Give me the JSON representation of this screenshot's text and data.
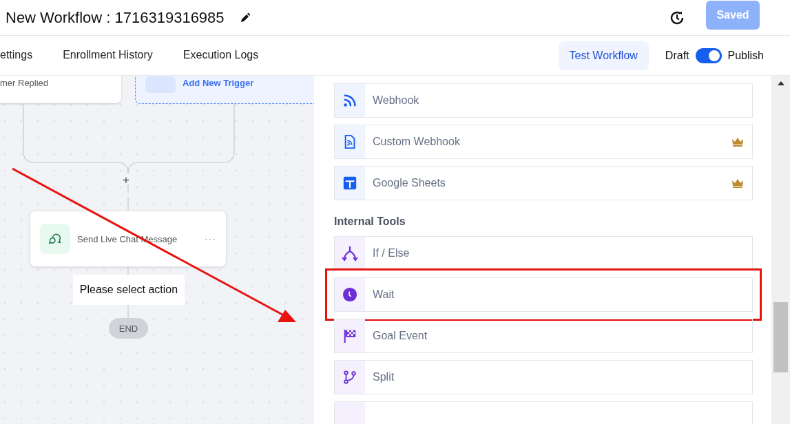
{
  "header": {
    "title": "New Workflow : 1716319316985",
    "save_button": "Saved"
  },
  "tabs": [
    {
      "label": "ettings",
      "selected": false
    },
    {
      "label": "Enrollment History",
      "selected": false
    },
    {
      "label": "Execution Logs",
      "selected": false
    }
  ],
  "test_button": "Test Workflow",
  "publish_toggle": {
    "off_label": "Draft",
    "on_label": "Publish",
    "on": true
  },
  "canvas": {
    "trigger_text": "mer Replied",
    "add_trigger": "Add New Trigger",
    "add_step": "+",
    "action_node": {
      "title": "Send Live Chat Message",
      "menu": "···"
    },
    "placeholder_node": "Please select action",
    "end_node": "END"
  },
  "sections": [
    {
      "items": [
        {
          "label": "Webhook",
          "kind": "rss",
          "premium": false
        },
        {
          "label": "Custom Webhook",
          "kind": "doc",
          "premium": true
        },
        {
          "label": "Google Sheets",
          "kind": "sheet",
          "premium": true
        }
      ]
    },
    {
      "heading": "Internal Tools",
      "items": [
        {
          "label": "If / Else",
          "kind": "fork",
          "premium": false
        },
        {
          "label": "Wait",
          "kind": "clock",
          "premium": false,
          "highlighted": true
        },
        {
          "label": "Goal Event",
          "kind": "flag",
          "premium": false
        },
        {
          "label": "Split",
          "kind": "branch",
          "premium": false
        },
        {
          "kind": "cut"
        }
      ]
    }
  ]
}
